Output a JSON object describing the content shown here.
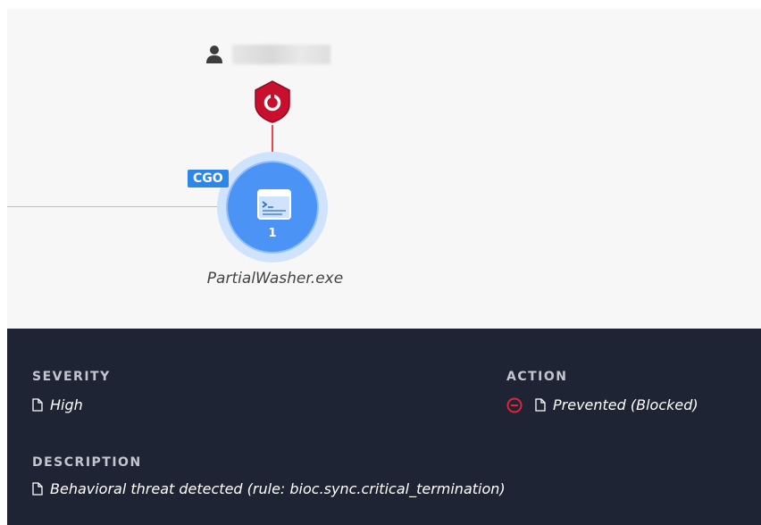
{
  "graph": {
    "tag": "CGO",
    "process_name": "PartialWasher.exe",
    "node_count": "1",
    "user_name": "██████"
  },
  "details": {
    "severity_label": "SEVERITY",
    "severity_value": "High",
    "action_label": "ACTION",
    "action_value": "Prevented (Blocked)",
    "description_label": "DESCRIPTION",
    "description_value": "Behavioral threat detected (rule: bioc.sync.critical_termination)"
  },
  "colors": {
    "panel_bg": "#1e2433",
    "node_blue": "#4b93f4",
    "alert_red": "#c8102e",
    "block_red": "#e0243a"
  }
}
